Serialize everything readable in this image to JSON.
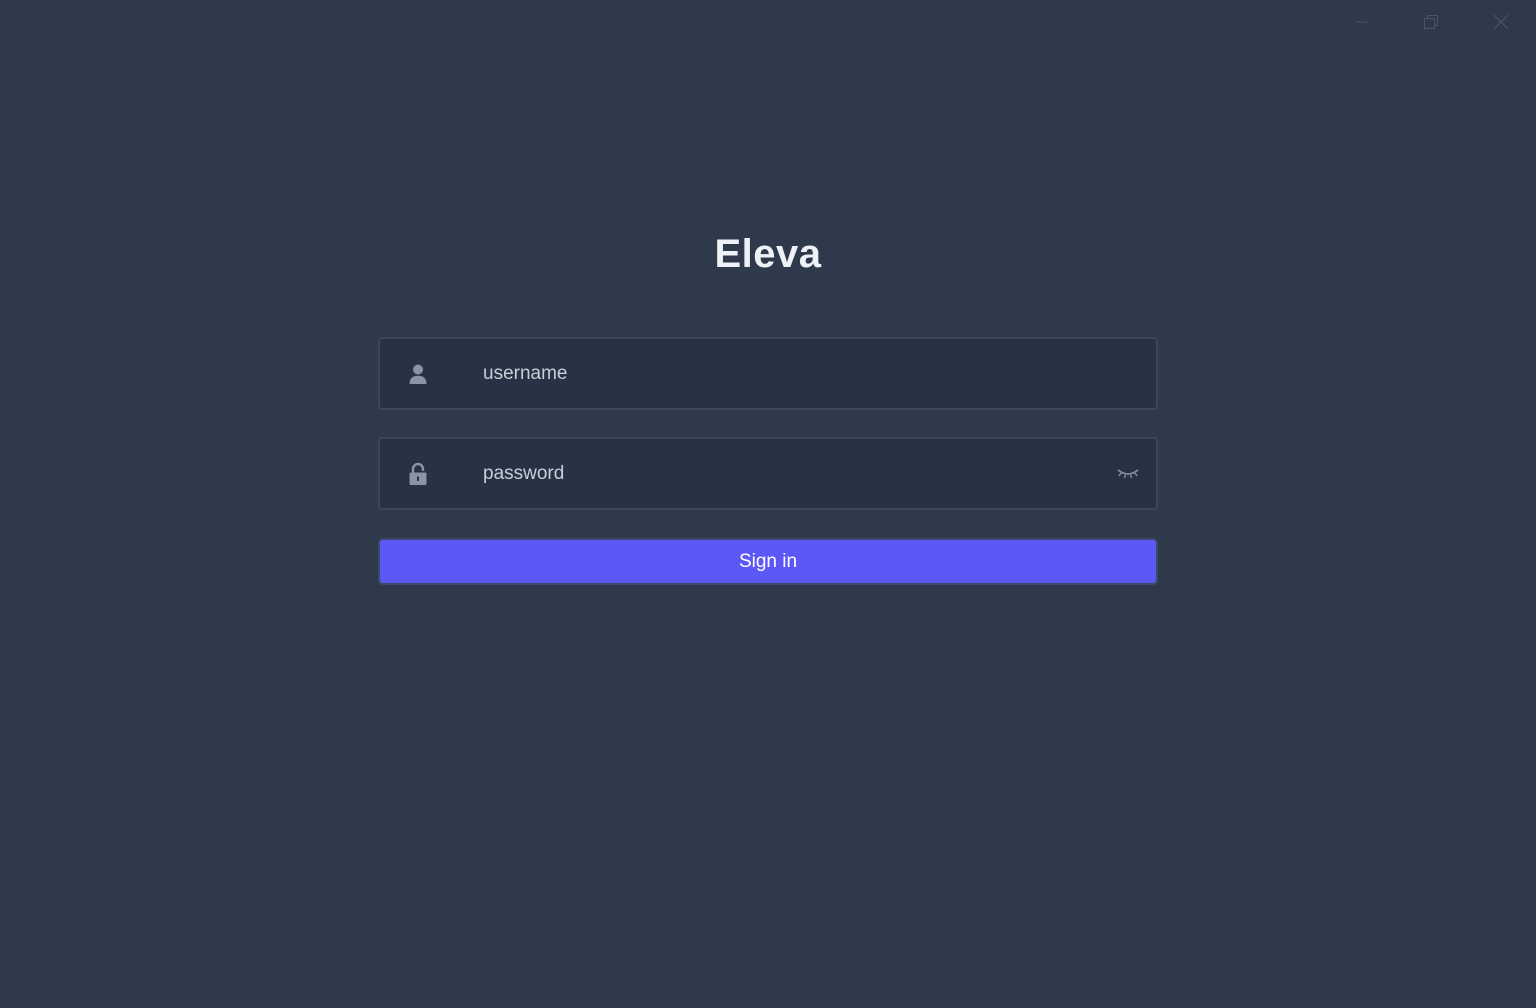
{
  "window": {
    "controls": [
      {
        "icon": "minimize-icon"
      },
      {
        "icon": "maximize-icon"
      },
      {
        "icon": "close-icon"
      }
    ]
  },
  "app": {
    "title": "Eleva"
  },
  "form": {
    "username": {
      "placeholder": "username",
      "value": "",
      "icon": "user-icon"
    },
    "password": {
      "placeholder": "password",
      "value": "",
      "icon": "lock-icon",
      "toggle_icon": "eye-closed-icon"
    },
    "submit_label": "Sign in"
  },
  "colors": {
    "background": "#2e3a4c",
    "field_background": "#273345",
    "field_border": "#3b4759",
    "accent": "#5b58f6",
    "icon": "#8a94a3"
  }
}
